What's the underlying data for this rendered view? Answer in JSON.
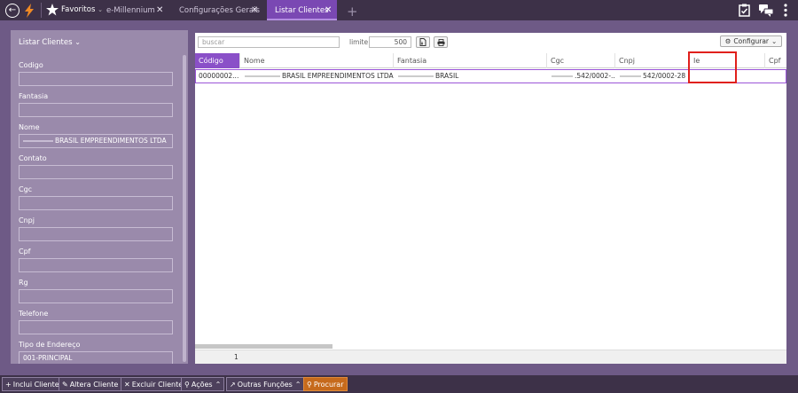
{
  "topbar": {
    "back_icon": "arrow-left-icon",
    "logo_icon": "lightning-logo-icon",
    "favorites_label": "Favoritos",
    "favorites_caret": "⌄",
    "tabs": [
      {
        "label": "e-Millennium"
      },
      {
        "label": "Configurações Gerais"
      },
      {
        "label": "Listar Clientes"
      }
    ],
    "add_tab": "+",
    "close_glyph": "✕"
  },
  "left_panel": {
    "title": "Listar Clientes",
    "fields": [
      {
        "label": "Codigo",
        "value": ""
      },
      {
        "label": "Fantasia",
        "value": ""
      },
      {
        "label": "Nome",
        "value": "BRASIL EMPREENDIMENTOS LTDA"
      },
      {
        "label": "Contato",
        "value": ""
      },
      {
        "label": "Cgc",
        "value": ""
      },
      {
        "label": "Cnpj",
        "value": ""
      },
      {
        "label": "Cpf",
        "value": ""
      },
      {
        "label": "Rg",
        "value": ""
      },
      {
        "label": "Telefone",
        "value": ""
      },
      {
        "label": "Tipo de Endereço",
        "value": "001-PRINCIPAL"
      }
    ]
  },
  "right_panel": {
    "search_placeholder": "buscar",
    "limit_label": "limite:",
    "limit_value": "500",
    "configure_label": "Configurar",
    "columns": [
      "Código",
      "Nome",
      "Fantasia",
      "Cgc",
      "Cnpj",
      "Ie",
      "Cpf"
    ],
    "rows": [
      {
        "codigo": "00000002...",
        "nome": "BRASIL EMPREENDIMENTOS LTDA.",
        "fantasia": "BRASIL",
        "cgc": ".542/0002-...",
        "cnpj": "542/0002-28",
        "ie": "",
        "cpf": ""
      }
    ],
    "page_number": "1"
  },
  "bottombar": {
    "buttons": [
      {
        "label": "Inclui Cliente",
        "icon": "plus-icon"
      },
      {
        "label": "Altera Cliente",
        "icon": "edit-icon"
      },
      {
        "label": "Excluir Cliente",
        "icon": "x-icon"
      },
      {
        "label": "Ações",
        "icon": "lightbulb-icon"
      },
      {
        "label": "Outras Funções",
        "icon": "external-link-icon"
      },
      {
        "label": "Procurar",
        "icon": "search-icon"
      }
    ]
  },
  "colors": {
    "accent": "#7a48b3",
    "highlight_box": "#e0201c",
    "search_button": "#c66a1c"
  }
}
